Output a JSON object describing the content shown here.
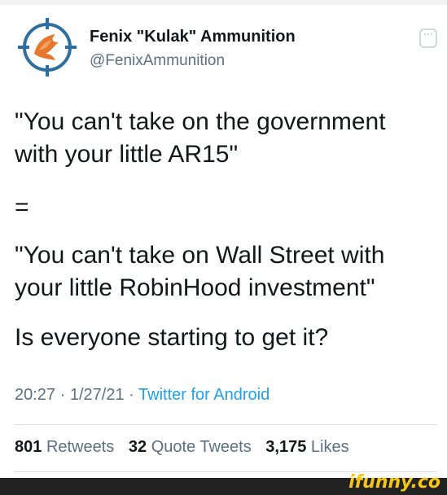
{
  "tweet": {
    "author_name": "Fenix \"Kulak\" Ammunition",
    "author_handle": "@FenixAmmunition",
    "text_lines": [
      "\"You can't take on the government",
      "with your little AR15\"",
      "=",
      "\"You can't take on Wall Street with",
      "your little RobinHood investment\"",
      "Is everyone starting to get it?"
    ],
    "time": "20:27",
    "separator": "·",
    "date": "1/27/21",
    "app": "Twitter for Android",
    "stats": {
      "retweets_count": "801",
      "retweets_label": "Retweets",
      "quotes_count": "32",
      "quotes_label": "Quote Tweets",
      "likes_count": "3,175",
      "likes_label": "Likes"
    }
  },
  "icons": {
    "avatar": "phoenix-crosshair-logo",
    "more": "more-options-icon"
  },
  "watermark": "ifunny.co",
  "colors": {
    "text": "#14171a",
    "secondary": "#5b7083",
    "link": "#1da1f2",
    "logo_orange": "#e8762b",
    "logo_blue": "#2f6f9f",
    "watermark": "#f5c518"
  }
}
